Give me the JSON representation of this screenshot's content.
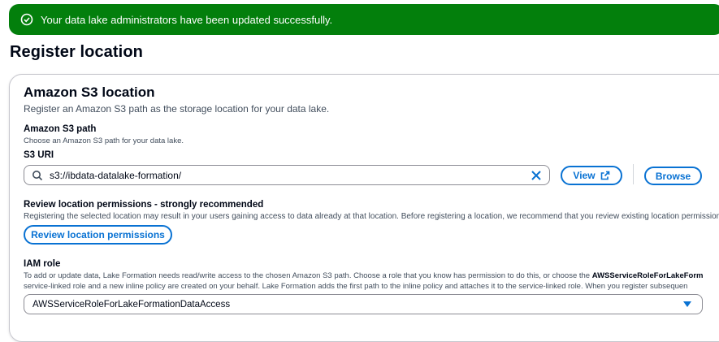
{
  "flash": {
    "message": "Your data lake administrators have been updated successfully.",
    "icon": "check-circle-icon",
    "color": "#037f0c"
  },
  "page": {
    "title": "Register location"
  },
  "section": {
    "title": "Amazon S3 location",
    "description": "Register an Amazon S3 path as the storage location for your data lake.",
    "s3_path_label": "Amazon S3 path",
    "s3_path_desc": "Choose an Amazon S3 path for your data lake.",
    "s3_uri_label": "S3 URI",
    "s3_uri_value": "s3://ibdata-datalake-formation/",
    "view_label": "View",
    "browse_label": "Browse",
    "review_title": "Review location permissions - strongly recommended",
    "review_desc": "Registering the selected location may result in your users gaining access to data already at that location. Before registering a location, we recommend that you review existing location permissions",
    "review_button": "Review location permissions",
    "iam_label": "IAM role",
    "iam_desc_1_pre": "To add or update data, Lake Formation needs read/write access to the chosen Amazon S3 path. Choose a role that you know has permission to do this, or choose the ",
    "iam_desc_1_bold": "AWSServiceRoleForLakeForm",
    "iam_desc_2": "service-linked role and a new inline policy are created on your behalf. Lake Formation adds the first path to the inline policy and attaches it to the service-linked role. When you register subsequen",
    "iam_selected": "AWSServiceRoleForLakeFormationDataAccess"
  },
  "colors": {
    "accent": "#0972d3",
    "success": "#037f0c"
  }
}
